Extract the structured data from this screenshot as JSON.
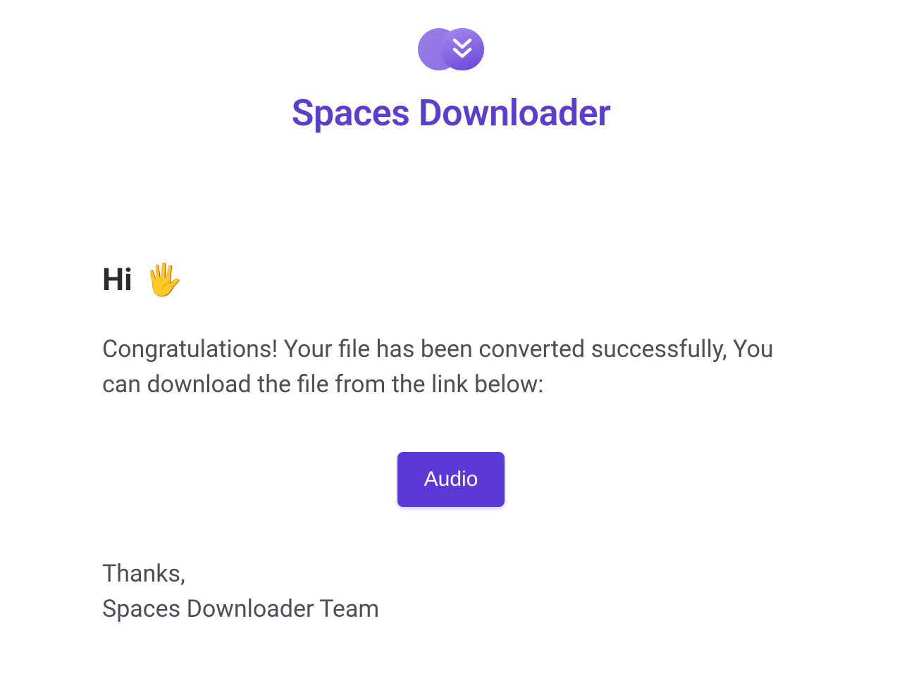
{
  "brand": {
    "title": "Spaces Downloader",
    "accent_color": "#5a39d6"
  },
  "greeting": {
    "text": "Hi",
    "emoji": "🖐"
  },
  "message": "Congratulations! Your file has been converted successfully, You can download the file from the link below:",
  "cta": {
    "label": "Audio"
  },
  "signoff": {
    "line1": "Thanks,",
    "line2": "Spaces Downloader Team"
  }
}
